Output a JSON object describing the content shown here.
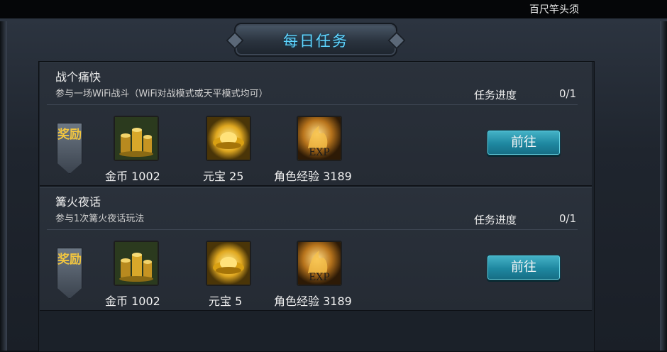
{
  "top_ticker": "百尺竿头须",
  "title": "每日任务",
  "progress_label": "任务进度",
  "reward_tag": "奖励",
  "go_label": "前往",
  "tasks": [
    {
      "name": "战个痛快",
      "desc": "参与一场WiFi战斗（WiFi对战模式或天平模式均可）",
      "progress": "0/1",
      "rewards": [
        {
          "icon": "gold-coins-icon",
          "label": "金币 1002"
        },
        {
          "icon": "yuanbao-icon",
          "label": "元宝 25"
        },
        {
          "icon": "exp-icon",
          "label": "角色经验 3189"
        }
      ]
    },
    {
      "name": "篝火夜话",
      "desc": "参与1次篝火夜话玩法",
      "progress": "0/1",
      "rewards": [
        {
          "icon": "gold-coins-icon",
          "label": "金币 1002"
        },
        {
          "icon": "yuanbao-icon",
          "label": "元宝 5"
        },
        {
          "icon": "exp-icon",
          "label": "角色经验 3189"
        }
      ]
    }
  ],
  "icon_text": {
    "exp": "EXP"
  },
  "colors": {
    "title": "#5fd5ff",
    "button": "#1e87a0",
    "reward_tag_text": "#f2c640",
    "icon_frame": "#3fa64a"
  }
}
